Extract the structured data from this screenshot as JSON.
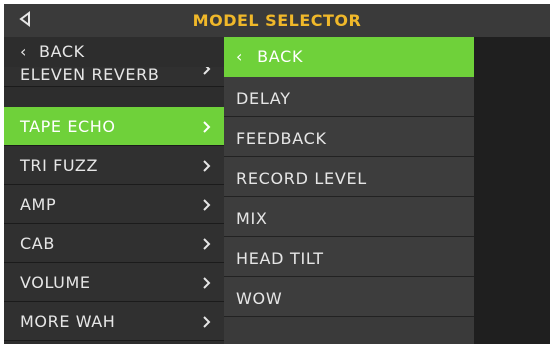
{
  "header": {
    "title": "MODEL SELECTOR",
    "back_icon": "triangle-left-icon",
    "title_color": "#f0b82a"
  },
  "left_menu": {
    "back_label": "BACK",
    "items": [
      {
        "label": "ELEVEN REVERB"
      },
      {
        "label": "TAPE ECHO",
        "selected": true
      },
      {
        "label": "TRI FUZZ"
      },
      {
        "label": "AMP"
      },
      {
        "label": "CAB"
      },
      {
        "label": "VOLUME"
      },
      {
        "label": "MORE WAH"
      }
    ]
  },
  "right_menu": {
    "back_label": "BACK",
    "items": [
      {
        "label": "DELAY"
      },
      {
        "label": "FEEDBACK"
      },
      {
        "label": "RECORD LEVEL"
      },
      {
        "label": "MIX"
      },
      {
        "label": "HEAD TILT"
      },
      {
        "label": "WOW"
      }
    ]
  },
  "colors": {
    "accent_green": "#6fd13a",
    "background": "#2a2a2a"
  }
}
